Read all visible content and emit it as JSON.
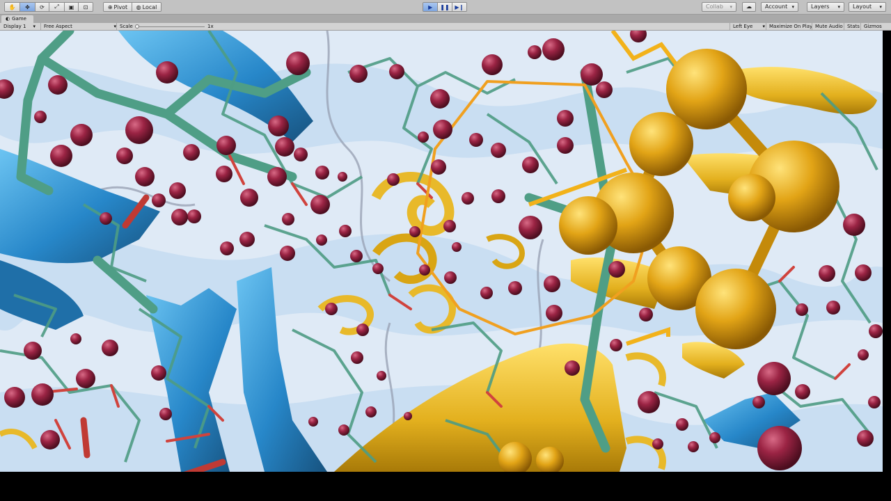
{
  "toolbar": {
    "pivot_label": "Pivot",
    "local_label": "Local",
    "collab_label": "Collab",
    "account_label": "Account",
    "layers_label": "Layers",
    "layout_label": "Layout"
  },
  "game_tab": {
    "label": "Game"
  },
  "game_bar": {
    "display_label": "Display 1",
    "aspect_label": "Free Aspect",
    "scale_label": "Scale",
    "scale_value": "1x",
    "scale_fraction": 0.0,
    "eye_label": "Left Eye",
    "maximize_label": "Maximize On Play",
    "mute_label": "Mute Audio",
    "stats_label": "Stats",
    "gizmos_label": "Gizmos"
  },
  "colors": {
    "toolbar_bg": "#c2c2c2",
    "play_active": "#7ea6e0",
    "viewport_bg": "#dce8f5",
    "backbone_green": "#4f9e86",
    "ribbon_blue": "#2c8fd0",
    "helix_gold": "#e8b92a",
    "atom_maroon": "#8c1f3a",
    "cluster_orange": "#d99a10"
  },
  "icons": [
    "hand-icon",
    "move-icon",
    "rotate-icon",
    "scale-icon",
    "rect-icon",
    "transform-icon",
    "pivot-icon",
    "globe-icon",
    "play-icon",
    "pause-icon",
    "step-icon",
    "cloud-icon",
    "game-icon"
  ]
}
